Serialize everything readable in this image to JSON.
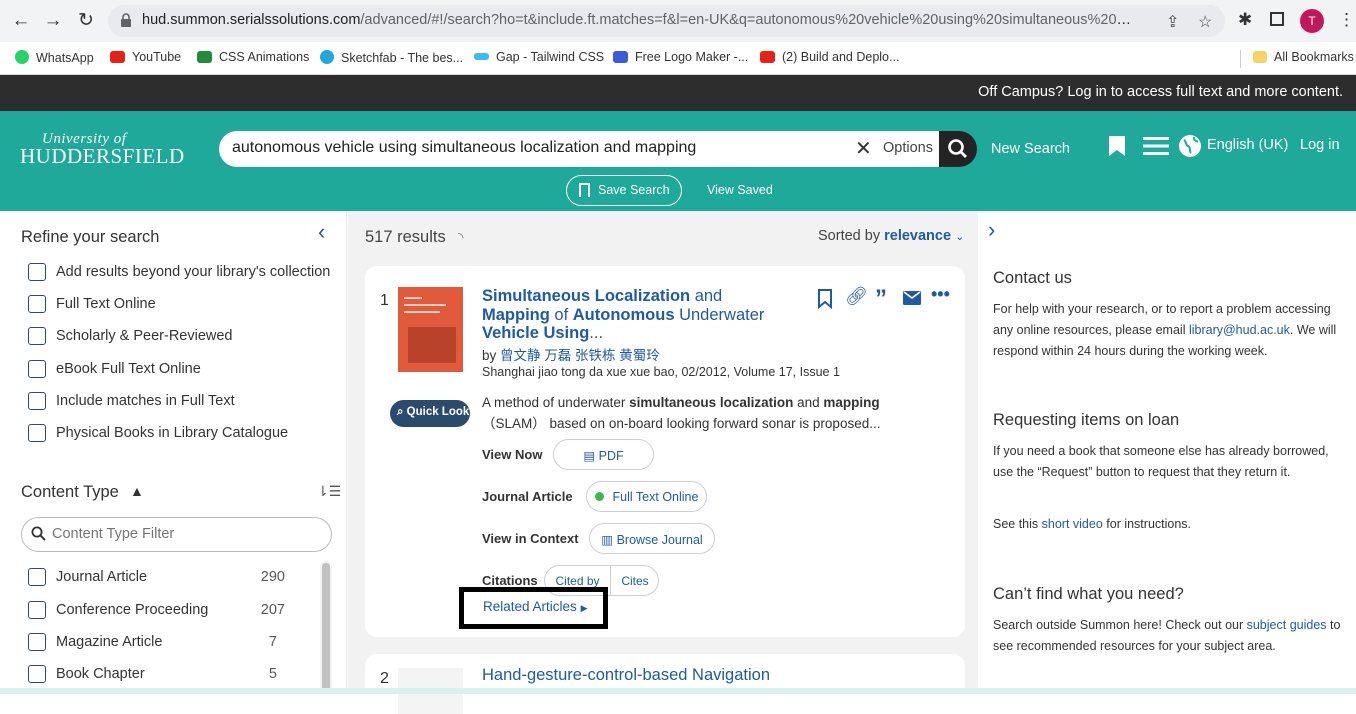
{
  "browser": {
    "url_host": "hud.summon.serialssolutions.com",
    "url_path": "/advanced/#!/search?ho=t&include.ft.matches=f&l=en-UK&q=autonomous%20vehicle%20using%20simultaneous%20localizatio...",
    "avatar_letter": "T",
    "bookmarks": [
      "WhatsApp",
      "YouTube",
      "CSS Animations",
      "Sketchfab - The bes...",
      "Gap - Tailwind CSS",
      "Free Logo Maker -...",
      "(2) Build and Deplo..."
    ],
    "all_bookmarks": "All Bookmarks"
  },
  "banner": {
    "text": "Off Campus? Log in to access full text and more content."
  },
  "header": {
    "logo_line1": "University of",
    "logo_line2": "HUDDERSFIELD",
    "search_value": "autonomous vehicle using simultaneous localization and mapping",
    "options_label": "Options",
    "new_search": "New Search",
    "language": "English (UK)",
    "login": "Log in",
    "save_search": "Save Search",
    "view_saved": "View Saved"
  },
  "refine": {
    "title": "Refine your search",
    "options": [
      "Add results beyond your library's collection",
      "Full Text Online",
      "Scholarly & Peer-Reviewed",
      "eBook Full Text Online",
      "Include matches in Full Text",
      "Physical Books in Library Catalogue"
    ],
    "content_type_title": "Content Type",
    "filter_placeholder": "Content Type Filter",
    "content_types": [
      {
        "label": "Journal Article",
        "count": "290"
      },
      {
        "label": "Conference Proceeding",
        "count": "207"
      },
      {
        "label": "Magazine Article",
        "count": "7"
      },
      {
        "label": "Book Chapter",
        "count": "5"
      }
    ]
  },
  "results": {
    "count_text": "517 results",
    "sorted_by": "Sorted by",
    "sort_value": "relevance",
    "items": [
      {
        "number": "1",
        "title_parts": [
          "Simultaneous Localization",
          " and ",
          "Mapping",
          " of ",
          "Autonomous",
          " Underwater ",
          "Vehicle Using",
          "..."
        ],
        "by": "by",
        "authors": "曾文静 万磊 张铁栋 黄蜀玲",
        "source": "Shanghai jiao tong da xue xue bao, 02/2012, Volume 17, Issue 1",
        "snippet_parts": [
          "A method of underwater ",
          "simultaneous localization",
          " and ",
          "mapping",
          "\n（SLAM） based on on-board looking forward sonar is proposed..."
        ],
        "quick_look": "Quick Look",
        "view_now": "View Now",
        "pdf": "PDF",
        "type_label": "Journal Article",
        "full_text": "Full Text Online",
        "view_context": "View in Context",
        "browse_journal": "Browse Journal",
        "citations": "Citations",
        "cited_by": "Cited by",
        "cites": "Cites",
        "related": "Related Articles"
      },
      {
        "number": "2",
        "title": "Hand-gesture-control-based Navigation"
      }
    ]
  },
  "right_panel": {
    "contact_title": "Contact us",
    "contact_text_1": "For help with your research, or to report a problem accessing any online resources, please email ",
    "contact_email": "library@hud.ac.uk",
    "contact_text_2": ". We will respond within 24 hours during the working week.",
    "loan_title": "Requesting items on loan",
    "loan_text": "If you need a book that someone else has already borrowed, use the “Request” button to request that they return it.",
    "loan_see": "See this ",
    "loan_link": "short video",
    "loan_after": " for instructions.",
    "cant_find_title": "Can’t find what you need?",
    "cant_find_text_1": "Search outside Summon here! Check out our ",
    "cant_find_link": "subject guides",
    "cant_find_text_2": " to see recommended resources for your subject area."
  }
}
